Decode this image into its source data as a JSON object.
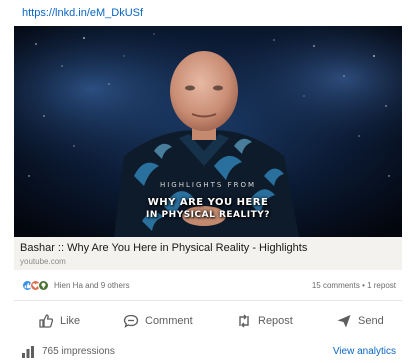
{
  "post": {
    "link": "https://lnkd.in/eM_DkUSf"
  },
  "video": {
    "highlight_label": "HIGHLIGHTS FROM",
    "title_line1": "WHY ARE YOU HERE",
    "title_line2": "IN PHYSICAL REALITY?",
    "icon": "video-thumbnail"
  },
  "link_card": {
    "title": "Bashar :: Why Are You Here in Physical Reality - Highlights",
    "source": "youtube.com"
  },
  "social": {
    "reaction_icons": [
      "like-reaction-icon",
      "love-reaction-icon",
      "insightful-reaction-icon"
    ],
    "names": "Hien Ha and 9 others",
    "counts": "15 comments • 1 repost"
  },
  "actions": {
    "like": "Like",
    "comment": "Comment",
    "repost": "Repost",
    "send": "Send"
  },
  "footer": {
    "impressions": "765 impressions",
    "analytics": "View analytics"
  },
  "colors": {
    "link": "#0a66c2",
    "like_reaction": "#378fe9",
    "love_reaction": "#df704d",
    "insight_reaction": "#44712e"
  }
}
